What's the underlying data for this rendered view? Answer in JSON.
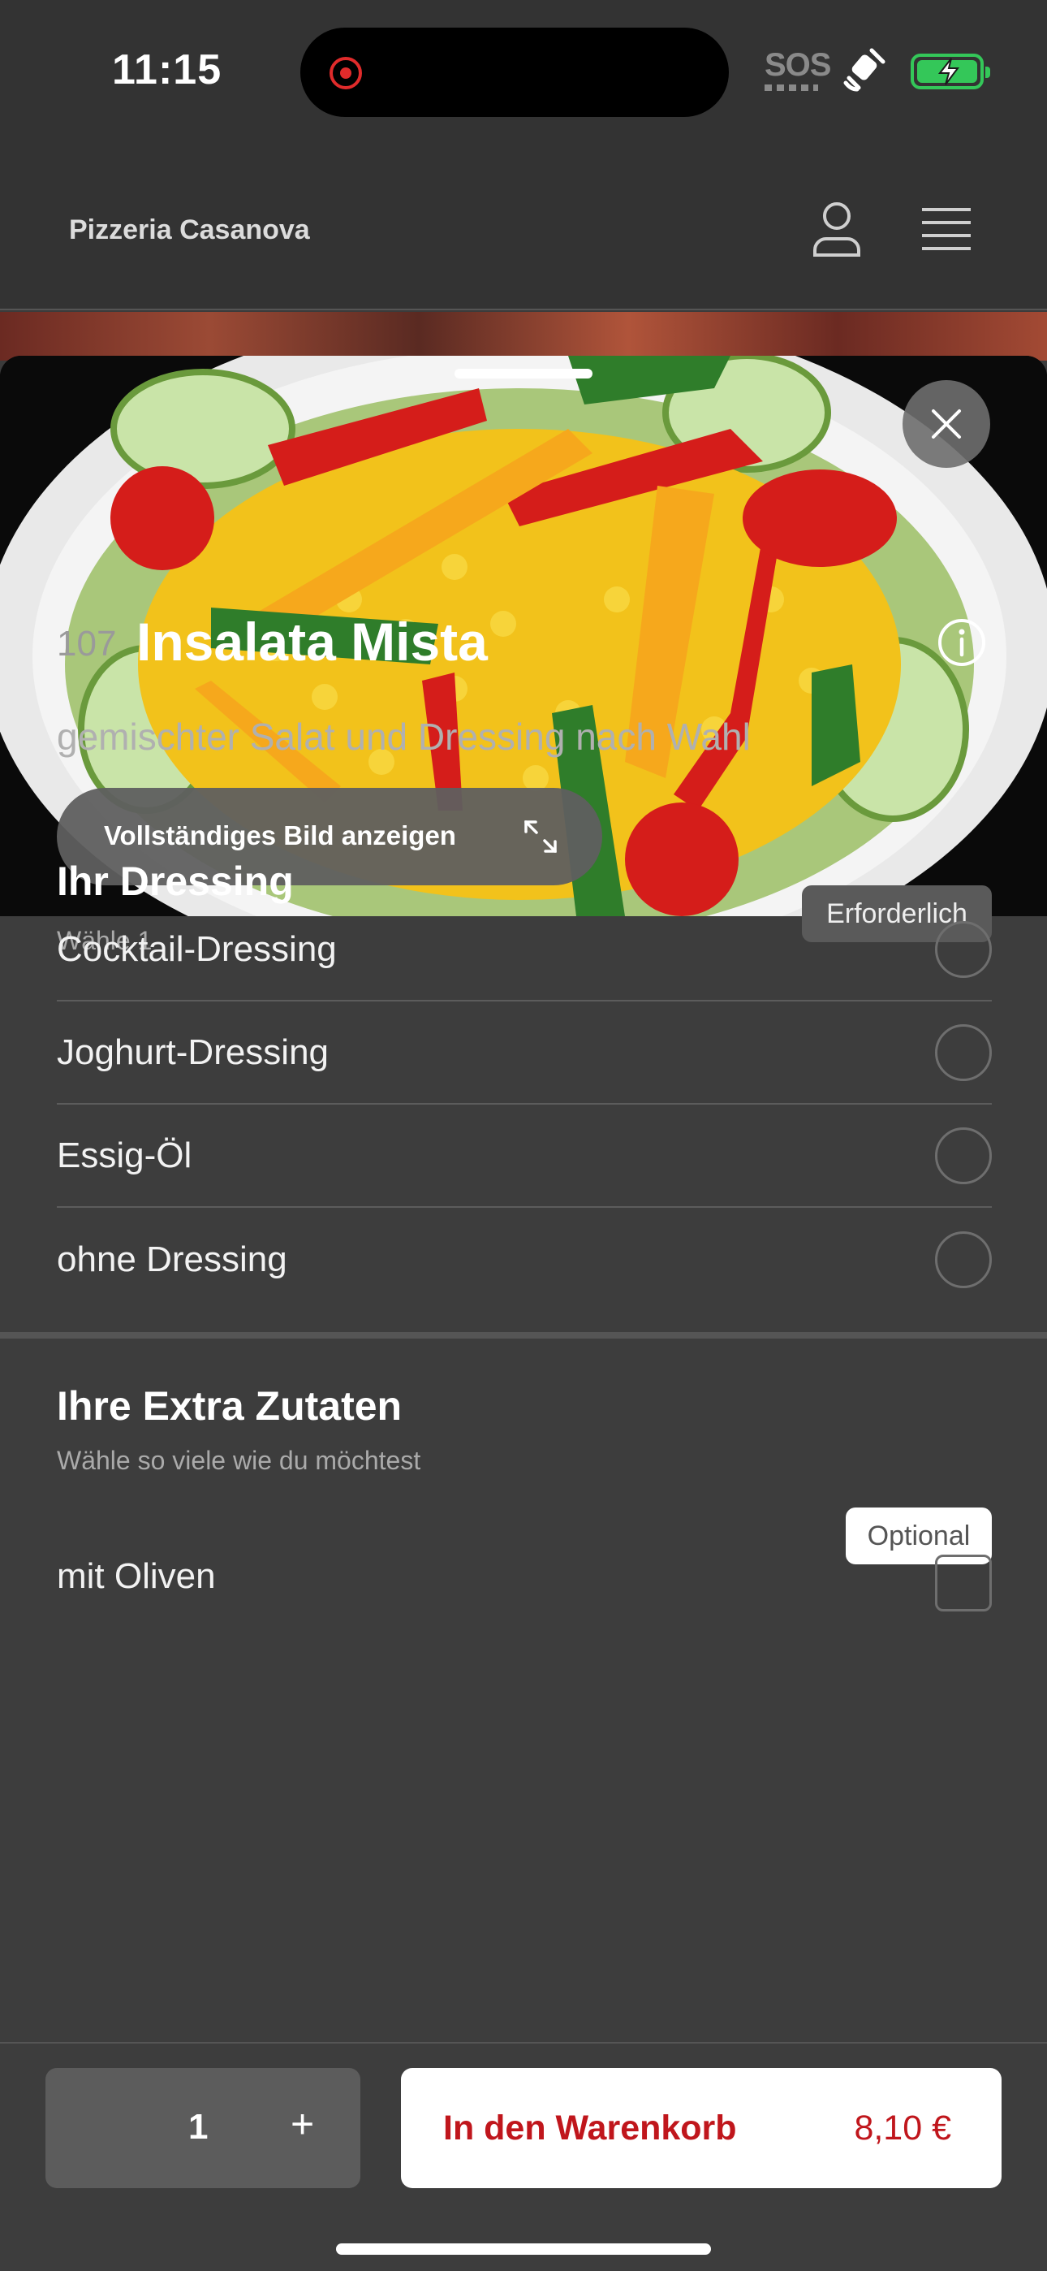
{
  "status_bar": {
    "time": "11:15",
    "sos": "SOS",
    "recording_icon": "screen-recording-icon",
    "satellite_icon": "satellite-icon",
    "battery_icon": "battery-charging-icon",
    "battery_color": "#34c759"
  },
  "header": {
    "brand": "Pizzeria Casanova",
    "user_icon": "user-icon",
    "menu_icon": "hamburger-menu-icon"
  },
  "hero": {
    "full_image_label": "Vollständiges Bild anzeigen",
    "close_icon": "close-icon",
    "expand_icon": "expand-icon"
  },
  "article": {
    "number": "107",
    "title": "Insalata Mista",
    "description": "gemischter Salat und Dressing nach Wahl",
    "info_icon": "info-icon"
  },
  "dressing_group": {
    "title": "Ihr Dressing",
    "subtitle": "Wähle 1",
    "badge": "Erforderlich",
    "options": [
      {
        "label": "Cocktail-Dressing"
      },
      {
        "label": "Joghurt-Dressing"
      },
      {
        "label": "Essig-Öl"
      },
      {
        "label": "ohne Dressing"
      }
    ]
  },
  "extras_group": {
    "title": "Ihre Extra Zutaten",
    "subtitle": "Wähle so viele wie du möchtest",
    "badge": "Optional",
    "options": [
      {
        "label": "mit Oliven"
      }
    ]
  },
  "bottom": {
    "quantity": "1",
    "plus": "+",
    "cart_label": "In den Warenkorb",
    "price": "8,10 €",
    "accent_color": "#c0161c"
  }
}
